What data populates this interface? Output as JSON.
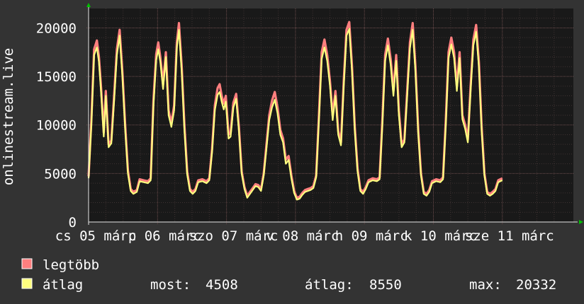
{
  "colors": {
    "background": "#333333",
    "plot_background": "#191919",
    "grid": "#6e4e4e",
    "minor_grid": "#3e3232",
    "axis": "#e8e8e8",
    "arrow": "#00c000",
    "max_series": "#ff7f7f",
    "avg_series": "#ffff7f"
  },
  "legend": {
    "max_label": "legtöbb",
    "avg_label": "átlag",
    "stats": [
      {
        "label": "most:",
        "value": "4508"
      },
      {
        "label": "átlag:",
        "value": "8550"
      },
      {
        "label": "max:",
        "value": "20332"
      }
    ]
  },
  "chart_data": {
    "type": "area",
    "ylabel": "onlinestream.live",
    "ylim": [
      0,
      22000
    ],
    "xlim": [
      0,
      7
    ],
    "yticks": [
      0,
      5000,
      10000,
      15000,
      20000
    ],
    "yticklabels": [
      "0",
      "5000",
      "10000",
      "15000",
      "20000"
    ],
    "xticks": [
      {
        "x": 0,
        "label": "cs 05 márc"
      },
      {
        "x": 1,
        "label": "p 06 márc"
      },
      {
        "x": 2,
        "label": "szo 07 márc"
      },
      {
        "x": 3,
        "label": "v 08 márc"
      },
      {
        "x": 4,
        "label": "h 09 márc"
      },
      {
        "x": 5,
        "label": "k 10 márc"
      },
      {
        "x": 6,
        "label": "sze 11 márc"
      }
    ],
    "grid": true,
    "series": [
      {
        "name": "legtöbb",
        "points": [
          [
            0.0,
            4700
          ],
          [
            0.04,
            10500
          ],
          [
            0.08,
            17800
          ],
          [
            0.12,
            18700
          ],
          [
            0.15,
            17000
          ],
          [
            0.18,
            14000
          ],
          [
            0.22,
            9200
          ],
          [
            0.25,
            13500
          ],
          [
            0.29,
            8000
          ],
          [
            0.33,
            8400
          ],
          [
            0.37,
            13000
          ],
          [
            0.41,
            17800
          ],
          [
            0.45,
            19800
          ],
          [
            0.49,
            15500
          ],
          [
            0.53,
            10000
          ],
          [
            0.57,
            5300
          ],
          [
            0.61,
            3400
          ],
          [
            0.65,
            3100
          ],
          [
            0.7,
            3300
          ],
          [
            0.74,
            4400
          ],
          [
            0.8,
            4300
          ],
          [
            0.86,
            4200
          ],
          [
            0.9,
            4500
          ],
          [
            0.94,
            12500
          ],
          [
            0.98,
            17300
          ],
          [
            1.01,
            18500
          ],
          [
            1.04,
            17000
          ],
          [
            1.08,
            14200
          ],
          [
            1.12,
            17500
          ],
          [
            1.16,
            11500
          ],
          [
            1.2,
            10200
          ],
          [
            1.24,
            12000
          ],
          [
            1.28,
            18500
          ],
          [
            1.31,
            20500
          ],
          [
            1.35,
            16000
          ],
          [
            1.39,
            10000
          ],
          [
            1.43,
            5200
          ],
          [
            1.47,
            3400
          ],
          [
            1.51,
            3100
          ],
          [
            1.55,
            3400
          ],
          [
            1.59,
            4300
          ],
          [
            1.65,
            4400
          ],
          [
            1.71,
            4200
          ],
          [
            1.75,
            4500
          ],
          [
            1.79,
            7500
          ],
          [
            1.83,
            12000
          ],
          [
            1.87,
            13800
          ],
          [
            1.9,
            14200
          ],
          [
            1.93,
            13000
          ],
          [
            1.96,
            12200
          ],
          [
            1.99,
            13000
          ],
          [
            2.03,
            9000
          ],
          [
            2.06,
            9200
          ],
          [
            2.1,
            12300
          ],
          [
            2.14,
            13200
          ],
          [
            2.18,
            9800
          ],
          [
            2.22,
            5200
          ],
          [
            2.26,
            3600
          ],
          [
            2.3,
            2700
          ],
          [
            2.34,
            3100
          ],
          [
            2.38,
            3500
          ],
          [
            2.42,
            3900
          ],
          [
            2.46,
            3800
          ],
          [
            2.5,
            3400
          ],
          [
            2.54,
            5000
          ],
          [
            2.58,
            8000
          ],
          [
            2.62,
            11000
          ],
          [
            2.66,
            12500
          ],
          [
            2.7,
            13400
          ],
          [
            2.74,
            11800
          ],
          [
            2.78,
            9500
          ],
          [
            2.82,
            8600
          ],
          [
            2.86,
            6400
          ],
          [
            2.9,
            6800
          ],
          [
            2.94,
            4800
          ],
          [
            2.98,
            3200
          ],
          [
            3.02,
            2500
          ],
          [
            3.06,
            2600
          ],
          [
            3.1,
            3000
          ],
          [
            3.14,
            3300
          ],
          [
            3.18,
            3400
          ],
          [
            3.22,
            3500
          ],
          [
            3.26,
            3700
          ],
          [
            3.3,
            4800
          ],
          [
            3.34,
            11000
          ],
          [
            3.38,
            17500
          ],
          [
            3.42,
            18800
          ],
          [
            3.46,
            17200
          ],
          [
            3.5,
            14500
          ],
          [
            3.54,
            11000
          ],
          [
            3.58,
            13500
          ],
          [
            3.62,
            9400
          ],
          [
            3.66,
            8200
          ],
          [
            3.7,
            14500
          ],
          [
            3.74,
            19800
          ],
          [
            3.78,
            20600
          ],
          [
            3.82,
            16000
          ],
          [
            3.86,
            9800
          ],
          [
            3.9,
            5500
          ],
          [
            3.94,
            3400
          ],
          [
            3.98,
            3100
          ],
          [
            4.02,
            3600
          ],
          [
            4.06,
            4300
          ],
          [
            4.12,
            4500
          ],
          [
            4.18,
            4400
          ],
          [
            4.22,
            4600
          ],
          [
            4.26,
            10500
          ],
          [
            4.3,
            17200
          ],
          [
            4.34,
            18900
          ],
          [
            4.38,
            16800
          ],
          [
            4.42,
            13500
          ],
          [
            4.46,
            17200
          ],
          [
            4.5,
            11500
          ],
          [
            4.54,
            8000
          ],
          [
            4.58,
            8500
          ],
          [
            4.62,
            13500
          ],
          [
            4.66,
            18500
          ],
          [
            4.7,
            20500
          ],
          [
            4.74,
            16000
          ],
          [
            4.78,
            9500
          ],
          [
            4.82,
            5000
          ],
          [
            4.86,
            3100
          ],
          [
            4.9,
            2900
          ],
          [
            4.94,
            3300
          ],
          [
            4.98,
            4200
          ],
          [
            5.04,
            4400
          ],
          [
            5.1,
            4300
          ],
          [
            5.14,
            4600
          ],
          [
            5.18,
            10500
          ],
          [
            5.22,
            17500
          ],
          [
            5.26,
            19000
          ],
          [
            5.3,
            17500
          ],
          [
            5.34,
            14000
          ],
          [
            5.38,
            17500
          ],
          [
            5.42,
            11000
          ],
          [
            5.46,
            10000
          ],
          [
            5.5,
            8500
          ],
          [
            5.54,
            14000
          ],
          [
            5.58,
            18800
          ],
          [
            5.62,
            20300
          ],
          [
            5.66,
            16500
          ],
          [
            5.7,
            9800
          ],
          [
            5.74,
            5000
          ],
          [
            5.78,
            3100
          ],
          [
            5.82,
            2900
          ],
          [
            5.86,
            3100
          ],
          [
            5.9,
            3400
          ],
          [
            5.94,
            4300
          ],
          [
            6.0,
            4500
          ]
        ]
      },
      {
        "name": "átlag",
        "points": [
          [
            0.0,
            4500
          ],
          [
            0.04,
            10000
          ],
          [
            0.08,
            17200
          ],
          [
            0.12,
            18000
          ],
          [
            0.15,
            16500
          ],
          [
            0.18,
            13500
          ],
          [
            0.22,
            8800
          ],
          [
            0.25,
            13000
          ],
          [
            0.29,
            7700
          ],
          [
            0.33,
            8100
          ],
          [
            0.37,
            12500
          ],
          [
            0.41,
            17200
          ],
          [
            0.45,
            19200
          ],
          [
            0.49,
            15000
          ],
          [
            0.53,
            9600
          ],
          [
            0.57,
            5000
          ],
          [
            0.61,
            3200
          ],
          [
            0.65,
            2900
          ],
          [
            0.7,
            3100
          ],
          [
            0.74,
            4200
          ],
          [
            0.8,
            4100
          ],
          [
            0.86,
            4000
          ],
          [
            0.9,
            4300
          ],
          [
            0.94,
            12000
          ],
          [
            0.98,
            16700
          ],
          [
            1.01,
            17800
          ],
          [
            1.04,
            16500
          ],
          [
            1.08,
            13700
          ],
          [
            1.12,
            17000
          ],
          [
            1.16,
            11000
          ],
          [
            1.2,
            9800
          ],
          [
            1.24,
            11500
          ],
          [
            1.28,
            18000
          ],
          [
            1.31,
            19800
          ],
          [
            1.35,
            15500
          ],
          [
            1.39,
            9500
          ],
          [
            1.43,
            4900
          ],
          [
            1.47,
            3200
          ],
          [
            1.51,
            2900
          ],
          [
            1.55,
            3200
          ],
          [
            1.59,
            4100
          ],
          [
            1.65,
            4200
          ],
          [
            1.71,
            4000
          ],
          [
            1.75,
            4300
          ],
          [
            1.79,
            7200
          ],
          [
            1.83,
            11500
          ],
          [
            1.87,
            13100
          ],
          [
            1.9,
            13400
          ],
          [
            1.93,
            12400
          ],
          [
            1.96,
            11600
          ],
          [
            1.99,
            12400
          ],
          [
            2.03,
            8600
          ],
          [
            2.06,
            8800
          ],
          [
            2.1,
            11800
          ],
          [
            2.14,
            12700
          ],
          [
            2.18,
            9400
          ],
          [
            2.22,
            5000
          ],
          [
            2.26,
            3400
          ],
          [
            2.3,
            2500
          ],
          [
            2.34,
            2900
          ],
          [
            2.38,
            3300
          ],
          [
            2.42,
            3700
          ],
          [
            2.46,
            3600
          ],
          [
            2.5,
            3200
          ],
          [
            2.54,
            4800
          ],
          [
            2.58,
            7600
          ],
          [
            2.62,
            10500
          ],
          [
            2.66,
            11800
          ],
          [
            2.7,
            12600
          ],
          [
            2.74,
            11200
          ],
          [
            2.78,
            9000
          ],
          [
            2.82,
            8200
          ],
          [
            2.86,
            6000
          ],
          [
            2.9,
            6400
          ],
          [
            2.94,
            4500
          ],
          [
            2.98,
            3000
          ],
          [
            3.02,
            2300
          ],
          [
            3.06,
            2400
          ],
          [
            3.1,
            2800
          ],
          [
            3.14,
            3100
          ],
          [
            3.18,
            3200
          ],
          [
            3.22,
            3300
          ],
          [
            3.26,
            3500
          ],
          [
            3.3,
            4600
          ],
          [
            3.34,
            10500
          ],
          [
            3.38,
            16800
          ],
          [
            3.42,
            18000
          ],
          [
            3.46,
            16600
          ],
          [
            3.5,
            14000
          ],
          [
            3.54,
            10500
          ],
          [
            3.58,
            13000
          ],
          [
            3.62,
            9000
          ],
          [
            3.66,
            7900
          ],
          [
            3.7,
            14000
          ],
          [
            3.74,
            19200
          ],
          [
            3.78,
            19900
          ],
          [
            3.82,
            15500
          ],
          [
            3.86,
            9400
          ],
          [
            3.9,
            5200
          ],
          [
            3.94,
            3200
          ],
          [
            3.98,
            2900
          ],
          [
            4.02,
            3400
          ],
          [
            4.06,
            4100
          ],
          [
            4.12,
            4300
          ],
          [
            4.18,
            4200
          ],
          [
            4.22,
            4400
          ],
          [
            4.26,
            10000
          ],
          [
            4.3,
            16600
          ],
          [
            4.34,
            18200
          ],
          [
            4.38,
            16200
          ],
          [
            4.42,
            13000
          ],
          [
            4.46,
            16600
          ],
          [
            4.5,
            11000
          ],
          [
            4.54,
            7700
          ],
          [
            4.58,
            8200
          ],
          [
            4.62,
            13000
          ],
          [
            4.66,
            17900
          ],
          [
            4.7,
            19800
          ],
          [
            4.74,
            15500
          ],
          [
            4.78,
            9100
          ],
          [
            4.82,
            4800
          ],
          [
            4.86,
            2900
          ],
          [
            4.9,
            2700
          ],
          [
            4.94,
            3100
          ],
          [
            4.98,
            4000
          ],
          [
            5.04,
            4200
          ],
          [
            5.1,
            4100
          ],
          [
            5.14,
            4400
          ],
          [
            5.18,
            10000
          ],
          [
            5.22,
            16900
          ],
          [
            5.26,
            18300
          ],
          [
            5.3,
            16900
          ],
          [
            5.34,
            13500
          ],
          [
            5.38,
            16900
          ],
          [
            5.42,
            10600
          ],
          [
            5.46,
            9600
          ],
          [
            5.5,
            8200
          ],
          [
            5.54,
            13500
          ],
          [
            5.58,
            18200
          ],
          [
            5.62,
            19600
          ],
          [
            5.66,
            16000
          ],
          [
            5.7,
            9400
          ],
          [
            5.74,
            4800
          ],
          [
            5.78,
            2900
          ],
          [
            5.82,
            2700
          ],
          [
            5.86,
            2900
          ],
          [
            5.9,
            3200
          ],
          [
            5.94,
            4100
          ],
          [
            6.0,
            4300
          ]
        ]
      }
    ]
  }
}
